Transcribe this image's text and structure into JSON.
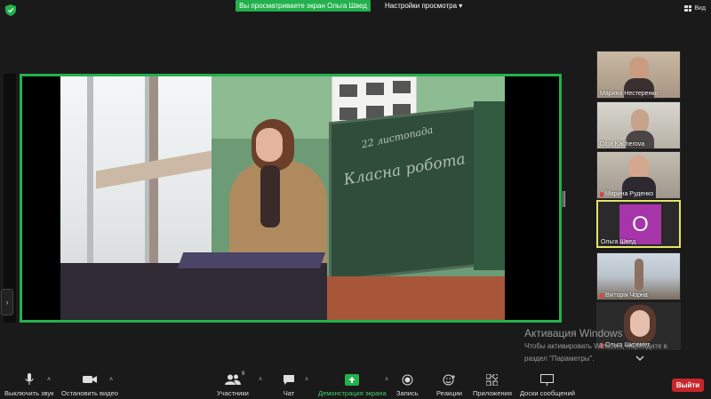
{
  "top": {
    "share_banner": "Вы просматриваете экран Ольга Швед",
    "view_settings": "Настройки просмотра",
    "view_button": "Вид"
  },
  "shared_screen": {
    "board_date": "22 листопада",
    "board_title": "Класна робота"
  },
  "participants": [
    {
      "name": "Марина Нестеренко",
      "muted": false,
      "active": false
    },
    {
      "name": "Olga Kacherova",
      "muted": false,
      "active": false
    },
    {
      "name": "Марина Руденко",
      "muted": true,
      "active": false
    },
    {
      "name": "Ольга Швед",
      "muted": false,
      "active": true,
      "avatar_letter": "О",
      "avatar_color": "#a535a8"
    },
    {
      "name": "Вікторія Чорна",
      "muted": true,
      "active": false
    },
    {
      "name": "Ольга Шкремет",
      "muted": true,
      "active": false
    }
  ],
  "activation": {
    "title": "Активация Windows",
    "line1": "Чтобы активировать Windows, перейдите в",
    "line2": "раздел \"Параметры\"."
  },
  "toolbar": {
    "mute": "Выключить звук",
    "stop_video": "Остановить видео",
    "participants": "Участники",
    "participants_count": "9",
    "chat": "Чат",
    "share_screen": "Демонстрация экрана",
    "record": "Запись",
    "reactions": "Реакции",
    "apps": "Приложения",
    "whiteboards": "Доски сообщений",
    "leave": "Выйти"
  },
  "colors": {
    "accent_green": "#22b14c",
    "leave_red": "#c8262a",
    "active_speaker": "#e3e36b"
  }
}
